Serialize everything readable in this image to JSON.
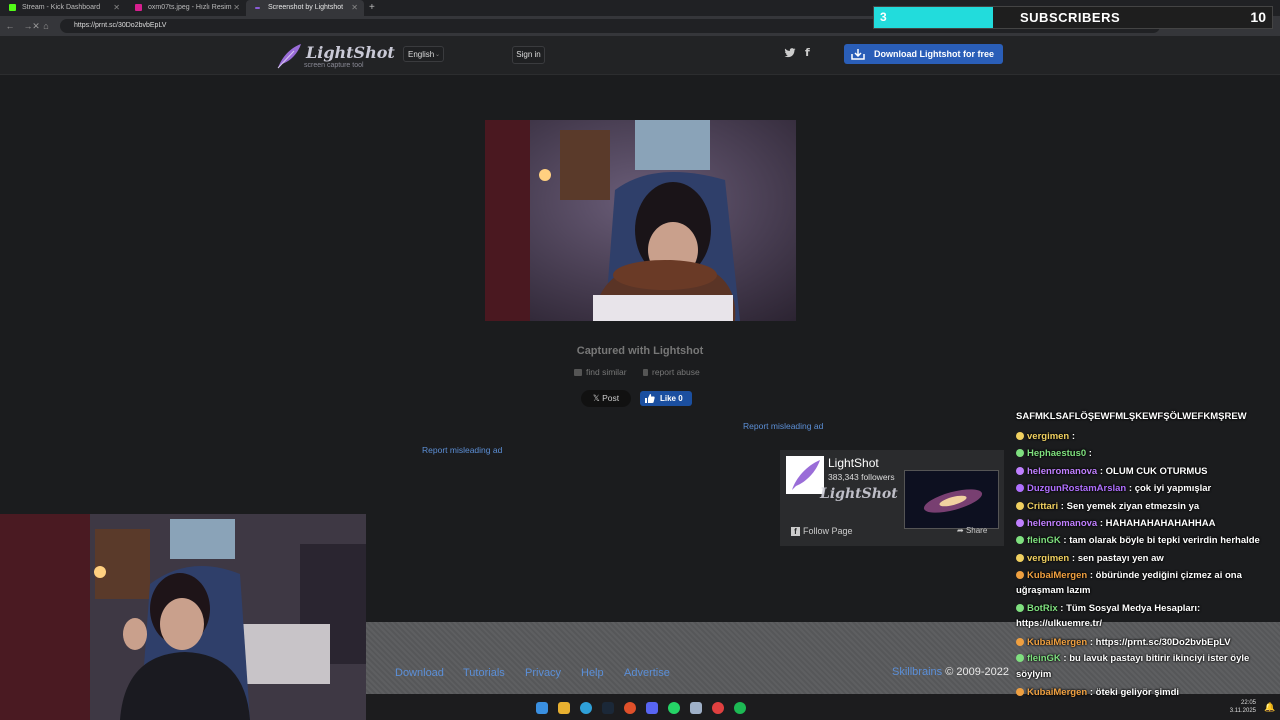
{
  "browser": {
    "tabs": [
      {
        "title": "Stream - Kick Dashboard",
        "color": "#53fc18"
      },
      {
        "title": "oxm07ts.jpeg - Hızlı Resim",
        "color": "#d61f8f"
      },
      {
        "title": "Screenshot by Lightshot",
        "color": "#8a5cd6"
      }
    ],
    "new_tab_icon": "plus-icon",
    "url": "https://prnt.sc/30Do2bvbEpLV"
  },
  "lightshot": {
    "logo_text": "LightShot",
    "logo_subtext": "screen capture tool",
    "language": "English",
    "signin": "Sign in",
    "download_button": "Download Lightshot for free",
    "captured": "Captured with Lightshot",
    "find_similar": "find similar",
    "report_abuse": "report abuse",
    "x_post": "Post",
    "fb_like": "Like 0",
    "report_ad_1": "Report misleading ad",
    "report_ad_2": "Report misleading ad",
    "fb_widget": {
      "name": "LightShot",
      "followers": "383,343 followers",
      "watermark": "LightShot",
      "follow": "Follow Page",
      "share": "Share"
    },
    "footer": {
      "links": [
        "Download",
        "Tutorials",
        "Privacy",
        "Help",
        "Advertise"
      ],
      "brand": "Skillbrains",
      "copyright": "© 2009-2022"
    }
  },
  "subscribers": {
    "current": "3",
    "label": "SUBSCRIBERS",
    "goal": "10",
    "progress": 0.3
  },
  "chat": {
    "header": "SAFMKLSAFLÖŞEWFMLŞKEWFŞÖLWEFKMŞREW",
    "messages": [
      {
        "user": "vergimen",
        "color": "#f0d060",
        "text": ""
      },
      {
        "user": "Hephaestus0",
        "color": "#7fe07f",
        "text": ""
      },
      {
        "user": "helenromanova",
        "color": "#c080ff",
        "text": "OLUM CUK OTURMUS"
      },
      {
        "user": "DuzgunRostamArslan",
        "color": "#b070ff",
        "text": "çok iyi yapmışlar"
      },
      {
        "user": "Crittari",
        "color": "#f0d060",
        "text": "Sen yemek ziyan etmezsin ya"
      },
      {
        "user": "helenromanova",
        "color": "#c080ff",
        "text": "HAHAHAHAHAHAHHAA"
      },
      {
        "user": "fleinGK",
        "color": "#7fe07f",
        "text": "tam olarak böyle bi tepki verirdin herhalde"
      },
      {
        "user": "vergimen",
        "color": "#f0d060",
        "text": "sen pastayı yen aw"
      },
      {
        "user": "KubaiMergen",
        "color": "#f0a040",
        "text": "öbüründe yediğini çizmez ai ona uğraşmam lazım"
      },
      {
        "user": "BotRix",
        "color": "#7fe07f",
        "text": "Tüm Sosyal Medya Hesapları: https://ulkuemre.tr/"
      },
      {
        "user": "KubaiMergen",
        "color": "#f0a040",
        "text": "https://prnt.sc/30Do2bvbEpLV"
      },
      {
        "user": "fleinGK",
        "color": "#7fe07f",
        "text": "bu lavuk pastayı bitirir ikinciyi ister öyle söylyim"
      },
      {
        "user": "KubaiMergen",
        "color": "#f0a040",
        "text": "öteki geliyör şimdi"
      }
    ]
  },
  "taskbar": {
    "time": "22:05",
    "date": "3.11.2025"
  }
}
